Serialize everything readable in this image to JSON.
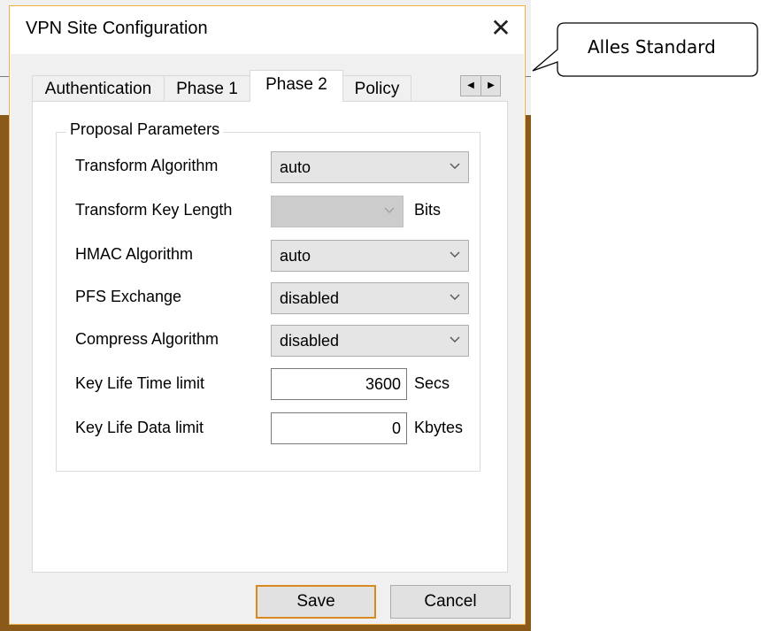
{
  "window": {
    "title": "VPN Site Configuration",
    "close_glyph": "✕"
  },
  "tabs": [
    {
      "label": "Authentication",
      "active": false
    },
    {
      "label": "Phase 1",
      "active": false
    },
    {
      "label": "Phase 2",
      "active": true
    },
    {
      "label": "Policy",
      "active": false
    }
  ],
  "tab_scroll": {
    "left": "◀",
    "right": "▶"
  },
  "group": {
    "title": "Proposal Parameters",
    "rows": [
      {
        "label": "Transform Algorithm",
        "type": "select",
        "value": "auto"
      },
      {
        "label": "Transform Key Length",
        "type": "select",
        "value": "",
        "disabled": true,
        "unit": "Bits"
      },
      {
        "label": "HMAC Algorithm",
        "type": "select",
        "value": "auto"
      },
      {
        "label": "PFS Exchange",
        "type": "select",
        "value": "disabled"
      },
      {
        "label": "Compress Algorithm",
        "type": "select",
        "value": "disabled"
      },
      {
        "label": "Key Life Time limit",
        "type": "input",
        "value": "3600",
        "unit": "Secs"
      },
      {
        "label": "Key Life Data limit",
        "type": "input",
        "value": "0",
        "unit": "Kbytes"
      }
    ]
  },
  "buttons": {
    "save": "Save",
    "cancel": "Cancel"
  },
  "callout": {
    "text": "Alles Standard"
  },
  "colors": {
    "accent_border": "#d88a1e",
    "background_brown": "#8a5a1a"
  }
}
